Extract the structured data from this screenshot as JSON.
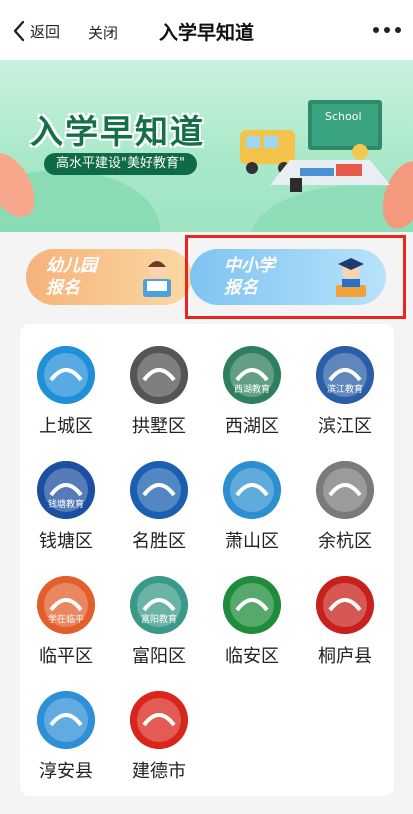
{
  "nav": {
    "back_label": "返回",
    "close_label": "关闭",
    "title": "入学早知道",
    "more_icon": "more-dots-icon"
  },
  "banner": {
    "title": "入学早知道",
    "subtitle": "高水平建设\"美好教育\"",
    "art_text": "School"
  },
  "entries": [
    {
      "line1": "幼儿园",
      "line2": "报名",
      "icon": "child-reading-icon"
    },
    {
      "line1": "中小学",
      "line2": "报名",
      "icon": "student-graduate-icon",
      "highlighted": true
    }
  ],
  "districts": [
    {
      "name": "上城区",
      "logo": "mountain-landscape-logo",
      "color": "#1f8fd8"
    },
    {
      "name": "拱墅区",
      "logo": "gray-red-swoosh-logo",
      "color": "#555555"
    },
    {
      "name": "西湖区",
      "logo": "xihu-education-logo",
      "color": "#2f7f5f",
      "logo_text": "西湖教育"
    },
    {
      "name": "滨江区",
      "logo": "binjiang-education-logo",
      "color": "#2a5fa8",
      "logo_text": "滨江教育"
    },
    {
      "name": "钱塘区",
      "logo": "qiantang-education-logo",
      "color": "#1d4fa0",
      "logo_text": "钱塘教育"
    },
    {
      "name": "名胜区",
      "logo": "mingsheng-wave-logo",
      "color": "#1a5fb0"
    },
    {
      "name": "萧山区",
      "logo": "xe-letters-logo",
      "color": "#2b8fd1"
    },
    {
      "name": "余杭区",
      "logo": "feather-pen-logo",
      "color": "#7a7a7a"
    },
    {
      "name": "临平区",
      "logo": "linping-colorful-logo",
      "color": "#e25f2b",
      "logo_text": "学在临平"
    },
    {
      "name": "富阳区",
      "logo": "fuyang-education-logo",
      "color": "#3a9a8a",
      "logo_text": "富阳教育"
    },
    {
      "name": "临安区",
      "logo": "green-book-logo",
      "color": "#1e8c3a"
    },
    {
      "name": "桐庐县",
      "logo": "tonglu-seal-logo",
      "color": "#c8201d"
    },
    {
      "name": "淳安县",
      "logo": "chunan-green-g-logo",
      "color": "#2e8fd6"
    },
    {
      "name": "建德市",
      "logo": "jiande-red-green-logo",
      "color": "#d9261c"
    }
  ]
}
